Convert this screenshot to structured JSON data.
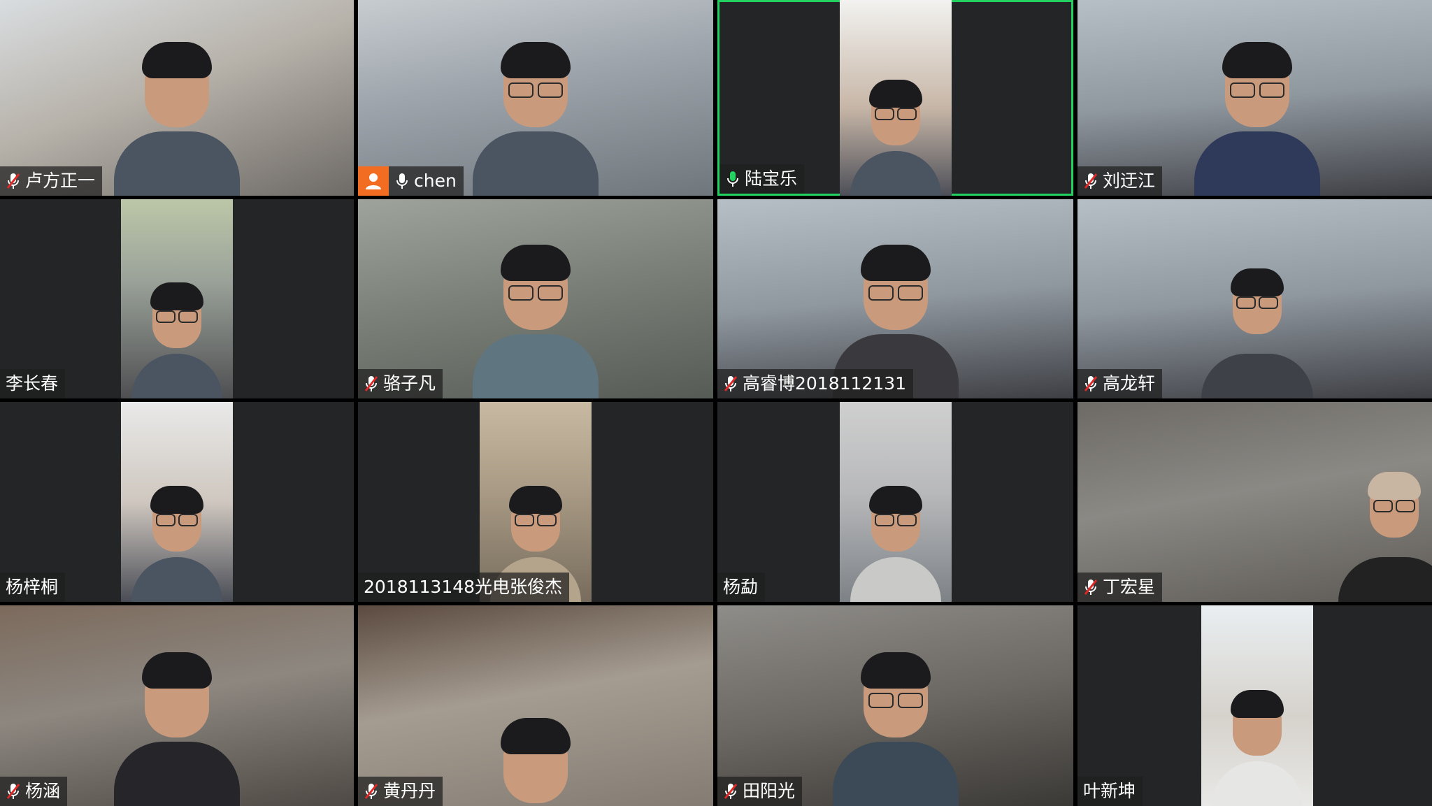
{
  "participants": [
    {
      "name": "卢方正一",
      "mic": "muted"
    },
    {
      "name": "chen",
      "mic": "on",
      "avatar_badge": true
    },
    {
      "name": "陆宝乐",
      "mic": "speaking",
      "active_speaker": true
    },
    {
      "name": "刘迂江",
      "mic": "muted"
    },
    {
      "name": "李长春",
      "mic": "none"
    },
    {
      "name": "骆子凡",
      "mic": "muted"
    },
    {
      "name": "高睿博2018112131",
      "mic": "muted"
    },
    {
      "name": "高龙轩",
      "mic": "muted"
    },
    {
      "name": "杨梓桐",
      "mic": "none"
    },
    {
      "name": "2018113148光电张俊杰",
      "mic": "none"
    },
    {
      "name": "杨勐",
      "mic": "none"
    },
    {
      "name": "丁宏星",
      "mic": "muted"
    },
    {
      "name": "杨涵",
      "mic": "muted"
    },
    {
      "name": "黄丹丹",
      "mic": "muted"
    },
    {
      "name": "田阳光",
      "mic": "muted"
    },
    {
      "name": "叶新坤",
      "mic": "none"
    }
  ],
  "colors": {
    "active_speaker_border": "#23d160",
    "speaking_mic": "#23d160",
    "muted_mic": "#e02828",
    "avatar_badge": "#f26d21",
    "tile_background": "#232527"
  }
}
